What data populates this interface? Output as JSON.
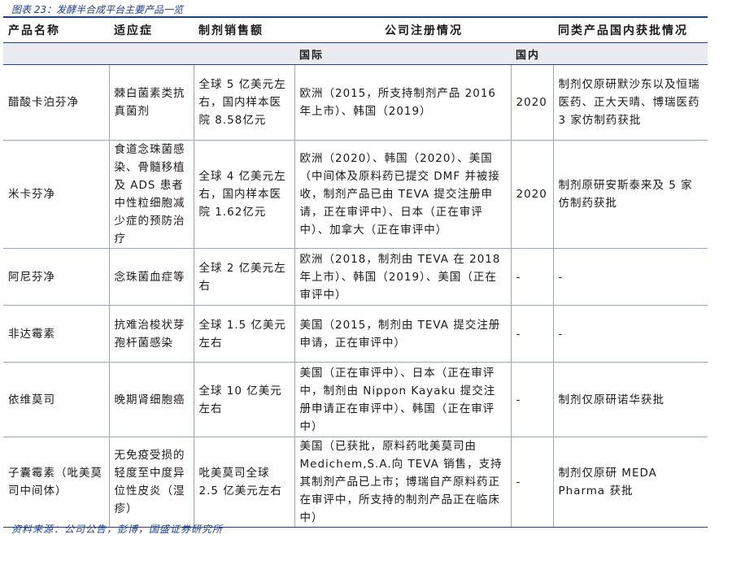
{
  "caption": "图表 23：发酵半合成平台主要产品一览",
  "headers": {
    "name": "产品名称",
    "indication": "适应症",
    "sales": "制剂销售额",
    "registration": "公司注册情况",
    "domestic_approval": "同类产品国内获批情况"
  },
  "subheaders": {
    "intl": "国际",
    "domestic": "国内"
  },
  "rows": [
    {
      "name": "醋酸卡泊芬净",
      "indication": "棘白菌素类抗真菌剂",
      "sales": "全球 5 亿美元左右，国内样本医院 8.58亿元",
      "intl": "欧洲（2015，所支持制剂产品 2016 年上市）、韩国（2019）",
      "domestic": "2020",
      "approval": "制剂仅原研默沙东以及恒瑞医药、正大天晴、博瑞医药 3 家仿制药获批"
    },
    {
      "name": "米卡芬净",
      "indication": "食道念珠菌感染、骨髓移植及 ADS 患者中性粒细胞减少症的预防治疗",
      "sales": "全球 4 亿美元左右，国内样本医院 1.62亿元",
      "intl": "欧洲（2020）、韩国（2020）、美国（中间体及原料药已提交 DMF 并被接收，制剂产品已由 TEVA 提交注册申请，正在审评中）、日本（正在审评中）、加拿大（正在审评中）",
      "domestic": "2020",
      "approval": "制剂原研安斯泰来及 5 家仿制药获批"
    },
    {
      "name": "阿尼芬净",
      "indication": "念珠菌血症等",
      "sales": "全球 2 亿美元左右",
      "intl": "欧洲（2018，制剂由 TEVA 在 2018 年上市）、韩国（2019）、美国（正在审评中）",
      "domestic": "-",
      "approval": "-"
    },
    {
      "name": "非达霉素",
      "indication": "抗难治梭状芽孢杆菌感染",
      "sales": "全球 1.5 亿美元左右",
      "intl": "美国（2015，制剂由 TEVA 提交注册申请，正在审评中）",
      "domestic": "-",
      "approval": "-"
    },
    {
      "name": "依维莫司",
      "indication": "晚期肾细胞癌",
      "sales": "全球 10 亿美元左右",
      "intl": "美国（正在审评中）、日本（正在审评中，制剂由 Nippon Kayaku 提交注册申请正在审评中）、韩国（正在审评中）",
      "domestic": "-",
      "approval": "制剂仅原研诺华获批"
    },
    {
      "name": "子囊霉素（吡美莫司中间体）",
      "indication": "无免疫受损的轻度至中度异位性皮炎（湿疹）",
      "sales": "吡美莫司全球 2.5 亿美元左右",
      "intl": "美国（已获批，原料药吡美莫司由 Medichem,S.A.向 TEVA 销售，支持其制剂产品已上市；博瑞自产原料药正在审评中，所支持的制剂产品正在临床中）",
      "domestic": "-",
      "approval": "制剂仅原研 MEDA Pharma 获批"
    }
  ],
  "source": "资料来源：公司公告，彭博，国盛证券研究所"
}
